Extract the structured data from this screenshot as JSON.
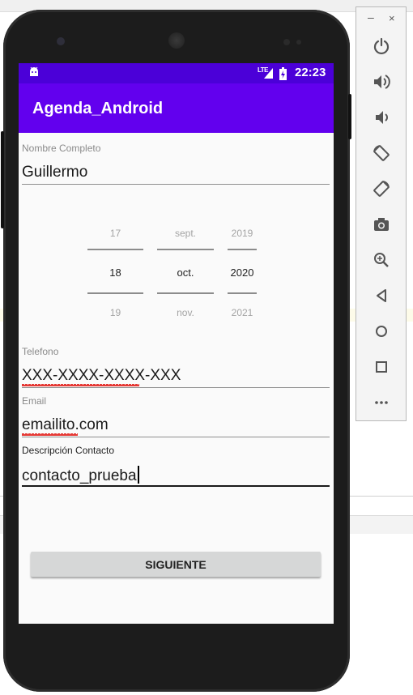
{
  "app": {
    "title": "Agenda_Android",
    "status_time": "22:23",
    "network_label": "LTE"
  },
  "form": {
    "name": {
      "label": "Nombre Completo",
      "value": "Guillermo"
    },
    "date_picker": {
      "days": {
        "prev": "17",
        "current": "18",
        "next": "19"
      },
      "months": {
        "prev": "sept.",
        "current": "oct.",
        "next": "nov."
      },
      "years": {
        "prev": "2019",
        "current": "2020",
        "next": "2021"
      }
    },
    "phone": {
      "label": "Telefono",
      "value": "XXX-XXXX-XXXX-XXX"
    },
    "email": {
      "label": "Email",
      "value": "emailito.com"
    },
    "description": {
      "label": "Descripción Contacto",
      "value": "contacto_prueba"
    },
    "next_button": "SIGUIENTE"
  },
  "colors": {
    "status_bar": "#4b00d8",
    "app_bar": "#6200ee",
    "button_bg": "#d6d7d7",
    "spell_underline": "#e53935"
  },
  "emulator_toolbar": {
    "minimize_label": "–",
    "close_label": "×",
    "buttons": [
      "power-icon",
      "volume-up-icon",
      "volume-down-icon",
      "rotate-left-icon",
      "rotate-right-icon",
      "screenshot-icon",
      "zoom-icon",
      "back-icon",
      "home-icon",
      "overview-icon",
      "more-icon"
    ]
  }
}
